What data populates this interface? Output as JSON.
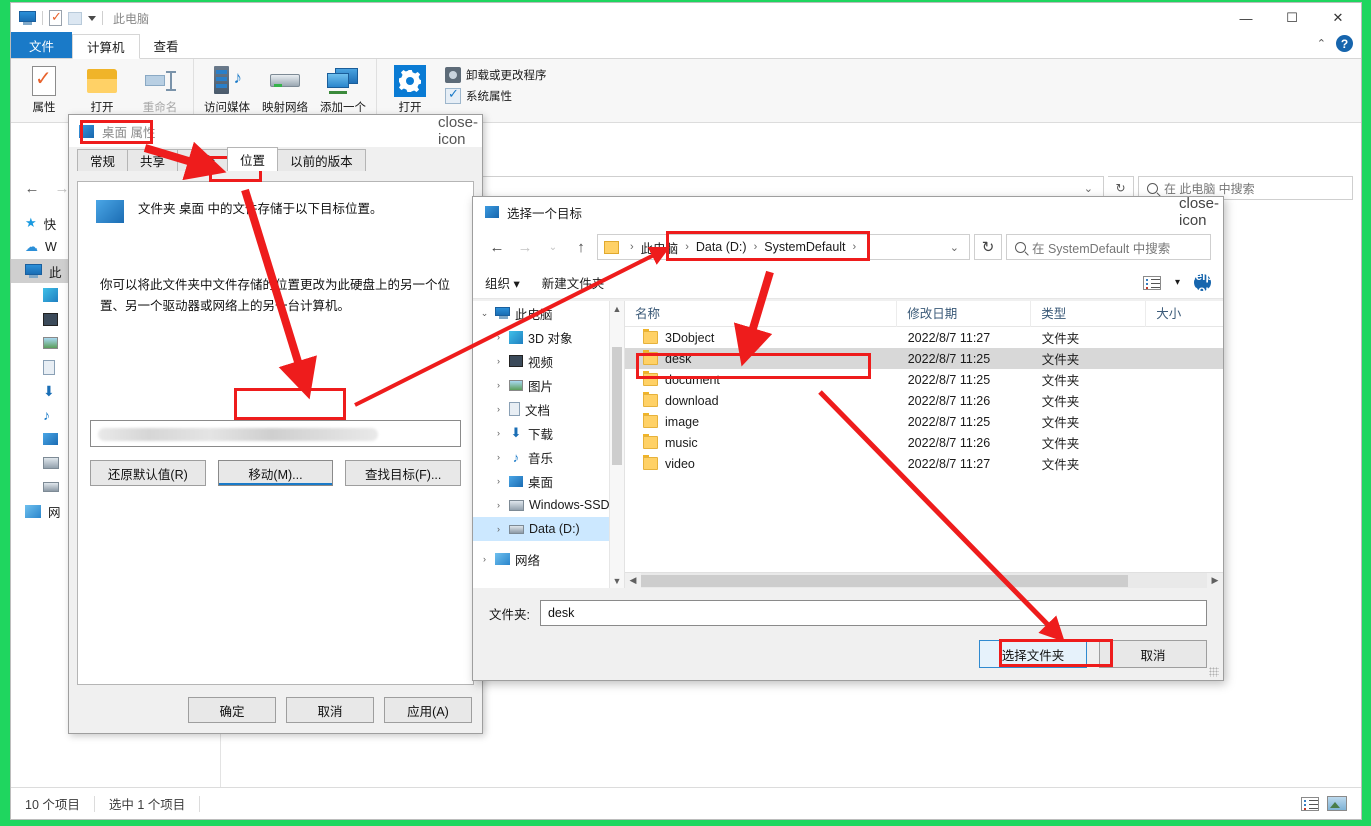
{
  "explorer": {
    "window_title": "此电脑",
    "quick_access_icons": [
      "monitor-icon",
      "properties-checkmark-icon",
      "folder-icon",
      "chevron-down-icon"
    ],
    "window_buttons": {
      "minimize": "—",
      "maximize": "☐",
      "close": "✕"
    },
    "ribbon_tabs": [
      {
        "label": "文件",
        "active": false,
        "style": "file"
      },
      {
        "label": "计算机",
        "active": true
      },
      {
        "label": "查看",
        "active": false
      }
    ],
    "ribbon_collapse": "⌃",
    "ribbon_help": "?",
    "ribbon_groups": [
      {
        "buttons": [
          {
            "label": "属性",
            "icon": "properties-icon",
            "dim": false
          },
          {
            "label": "打开",
            "icon": "open-folder-icon",
            "dim": false
          },
          {
            "label": "重命名",
            "icon": "rename-icon",
            "dim": true
          }
        ]
      },
      {
        "buttons": [
          {
            "label": "访问媒体",
            "icon": "media-server-icon",
            "dim": false
          },
          {
            "label": "映射网络",
            "icon": "map-drive-icon",
            "dim": false
          },
          {
            "label": "添加一个",
            "icon": "add-network-location-icon",
            "dim": false
          }
        ]
      },
      {
        "buttons": [
          {
            "label": "打开",
            "icon": "settings-gear-icon",
            "dim": false
          }
        ],
        "small_items": [
          {
            "label": "卸载或更改程序",
            "icon": "uninstall-icon"
          },
          {
            "label": "系统属性",
            "icon": "system-properties-icon"
          }
        ]
      }
    ],
    "address": {
      "back_icon": "back-arrow-icon",
      "forward_icon": "forward-arrow-icon",
      "recent_icon": "chevron-down-icon",
      "up_icon": "up-arrow-icon",
      "dropdown_icon": "chevron-down-icon",
      "refresh_icon": "refresh-icon"
    },
    "search": {
      "placeholder": "在 此电脑 中搜索",
      "icon": "search-icon"
    },
    "nav_items": [
      {
        "label": "快",
        "icon": "quick-access-star-icon",
        "selected": false,
        "child": false
      },
      {
        "label": "W",
        "icon": "onedrive-cloud-icon",
        "selected": false,
        "child": false
      },
      {
        "label": "此",
        "icon": "this-pc-icon",
        "selected": true,
        "child": false
      },
      {
        "label": "",
        "icon": "3d-objects-icon",
        "selected": false,
        "child": true
      },
      {
        "label": "",
        "icon": "videos-icon",
        "selected": false,
        "child": true
      },
      {
        "label": "",
        "icon": "pictures-icon",
        "selected": false,
        "child": true
      },
      {
        "label": "",
        "icon": "documents-icon",
        "selected": false,
        "child": true
      },
      {
        "label": "",
        "icon": "downloads-icon",
        "selected": false,
        "child": true
      },
      {
        "label": "",
        "icon": "music-icon",
        "selected": false,
        "child": true
      },
      {
        "label": "",
        "icon": "desktop-icon",
        "selected": false,
        "child": true
      },
      {
        "label": "",
        "icon": "ssd-drive-icon",
        "selected": false,
        "child": true
      },
      {
        "label": "",
        "icon": "hard-drive-icon",
        "selected": false,
        "child": true
      },
      {
        "label": "网",
        "icon": "network-icon",
        "selected": false,
        "child": false
      }
    ],
    "status": {
      "item_count": "10 个项目",
      "selection": "选中 1 个项目",
      "view_details_icon": "details-view-icon",
      "view_large_icon": "large-icons-view-icon"
    }
  },
  "properties_dialog": {
    "title": "桌面 属性",
    "title_icon": "desktop-folder-icon",
    "close_icon": "close-icon",
    "tabs": [
      {
        "label": "常规",
        "active": false
      },
      {
        "label": "共享",
        "active": false
      },
      {
        "label": "安全",
        "active": false
      },
      {
        "label": "位置",
        "active": true
      },
      {
        "label": "以前的版本",
        "active": false
      }
    ],
    "header_text": "文件夹 桌面 中的文件存储于以下目标位置。",
    "description": "你可以将此文件夹中文件存储的位置更改为此硬盘上的另一个位置、另一个驱动器或网络上的另一台计算机。",
    "path_value": "",
    "path_redacted": true,
    "action_buttons": [
      {
        "label": "还原默认值(R)",
        "focused": false
      },
      {
        "label": "移动(M)...",
        "focused": true
      },
      {
        "label": "查找目标(F)...",
        "focused": false
      }
    ],
    "footer_buttons": [
      {
        "label": "确定"
      },
      {
        "label": "取消"
      },
      {
        "label": "应用(A)"
      }
    ]
  },
  "picker_dialog": {
    "title": "选择一个目标",
    "title_icon": "folder-picker-icon",
    "close_icon": "close-icon",
    "breadcrumb": {
      "folder_icon": "folder-icon",
      "parts": [
        "此电脑",
        "Data (D:)",
        "SystemDefault"
      ],
      "separator": "›",
      "dropdown_icon": "chevron-down-icon",
      "refresh_icon": "refresh-icon"
    },
    "search": {
      "placeholder": "在 SystemDefault 中搜索",
      "icon": "search-icon"
    },
    "toolbar": {
      "organize": "组织",
      "organize_caret": "▾",
      "new_folder": "新建文件夹",
      "view_icon": "view-options-icon",
      "view_caret": "▾",
      "help_icon": "help-icon"
    },
    "tree": [
      {
        "label": "此电脑",
        "icon": "this-pc-icon",
        "expander": "⌄",
        "child": false,
        "selected": false
      },
      {
        "label": "3D 对象",
        "icon": "3d-objects-icon",
        "expander": "›",
        "child": true,
        "selected": false
      },
      {
        "label": "视频",
        "icon": "videos-icon",
        "expander": "›",
        "child": true,
        "selected": false
      },
      {
        "label": "图片",
        "icon": "pictures-icon",
        "expander": "›",
        "child": true,
        "selected": false
      },
      {
        "label": "文档",
        "icon": "documents-icon",
        "expander": "›",
        "child": true,
        "selected": false
      },
      {
        "label": "下载",
        "icon": "downloads-icon",
        "expander": "›",
        "child": true,
        "selected": false
      },
      {
        "label": "音乐",
        "icon": "music-icon",
        "expander": "›",
        "child": true,
        "selected": false
      },
      {
        "label": "桌面",
        "icon": "desktop-icon",
        "expander": "›",
        "child": true,
        "selected": false
      },
      {
        "label": "Windows-SSD",
        "icon": "ssd-drive-icon",
        "expander": "›",
        "child": true,
        "selected": false
      },
      {
        "label": "Data (D:)",
        "icon": "hard-drive-icon",
        "expander": "›",
        "child": true,
        "selected": true
      },
      {
        "label": "网络",
        "icon": "network-icon",
        "expander": "›",
        "child": false,
        "selected": false
      }
    ],
    "columns": [
      "名称",
      "修改日期",
      "类型",
      "大小"
    ],
    "rows": [
      {
        "name": "3Dobject",
        "date": "2022/8/7 11:27",
        "type": "文件夹",
        "size": "",
        "selected": false
      },
      {
        "name": "desk",
        "date": "2022/8/7 11:25",
        "type": "文件夹",
        "size": "",
        "selected": true
      },
      {
        "name": "document",
        "date": "2022/8/7 11:25",
        "type": "文件夹",
        "size": "",
        "selected": false
      },
      {
        "name": "download",
        "date": "2022/8/7 11:26",
        "type": "文件夹",
        "size": "",
        "selected": false
      },
      {
        "name": "image",
        "date": "2022/8/7 11:25",
        "type": "文件夹",
        "size": "",
        "selected": false
      },
      {
        "name": "music",
        "date": "2022/8/7 11:26",
        "type": "文件夹",
        "size": "",
        "selected": false
      },
      {
        "name": "video",
        "date": "2022/8/7 11:27",
        "type": "文件夹",
        "size": "",
        "selected": false
      }
    ],
    "footer": {
      "folder_label": "文件夹:",
      "folder_value": "desk",
      "select_button": "选择文件夹",
      "cancel_button": "取消"
    }
  },
  "annotations": {
    "accent_color": "#ee1c1c",
    "boxes": [
      {
        "name": "properties-title-highlight"
      },
      {
        "name": "location-tab-highlight"
      },
      {
        "name": "move-button-highlight"
      },
      {
        "name": "breadcrumb-path-highlight"
      },
      {
        "name": "desk-row-highlight"
      },
      {
        "name": "select-folder-button-highlight"
      }
    ],
    "arrows": [
      {
        "name": "arrow-title-to-location-tab"
      },
      {
        "name": "arrow-location-tab-to-move-button"
      },
      {
        "name": "arrow-move-button-to-breadcrumb"
      },
      {
        "name": "arrow-breadcrumb-to-desk-row"
      },
      {
        "name": "arrow-desk-row-to-select-folder"
      }
    ]
  }
}
